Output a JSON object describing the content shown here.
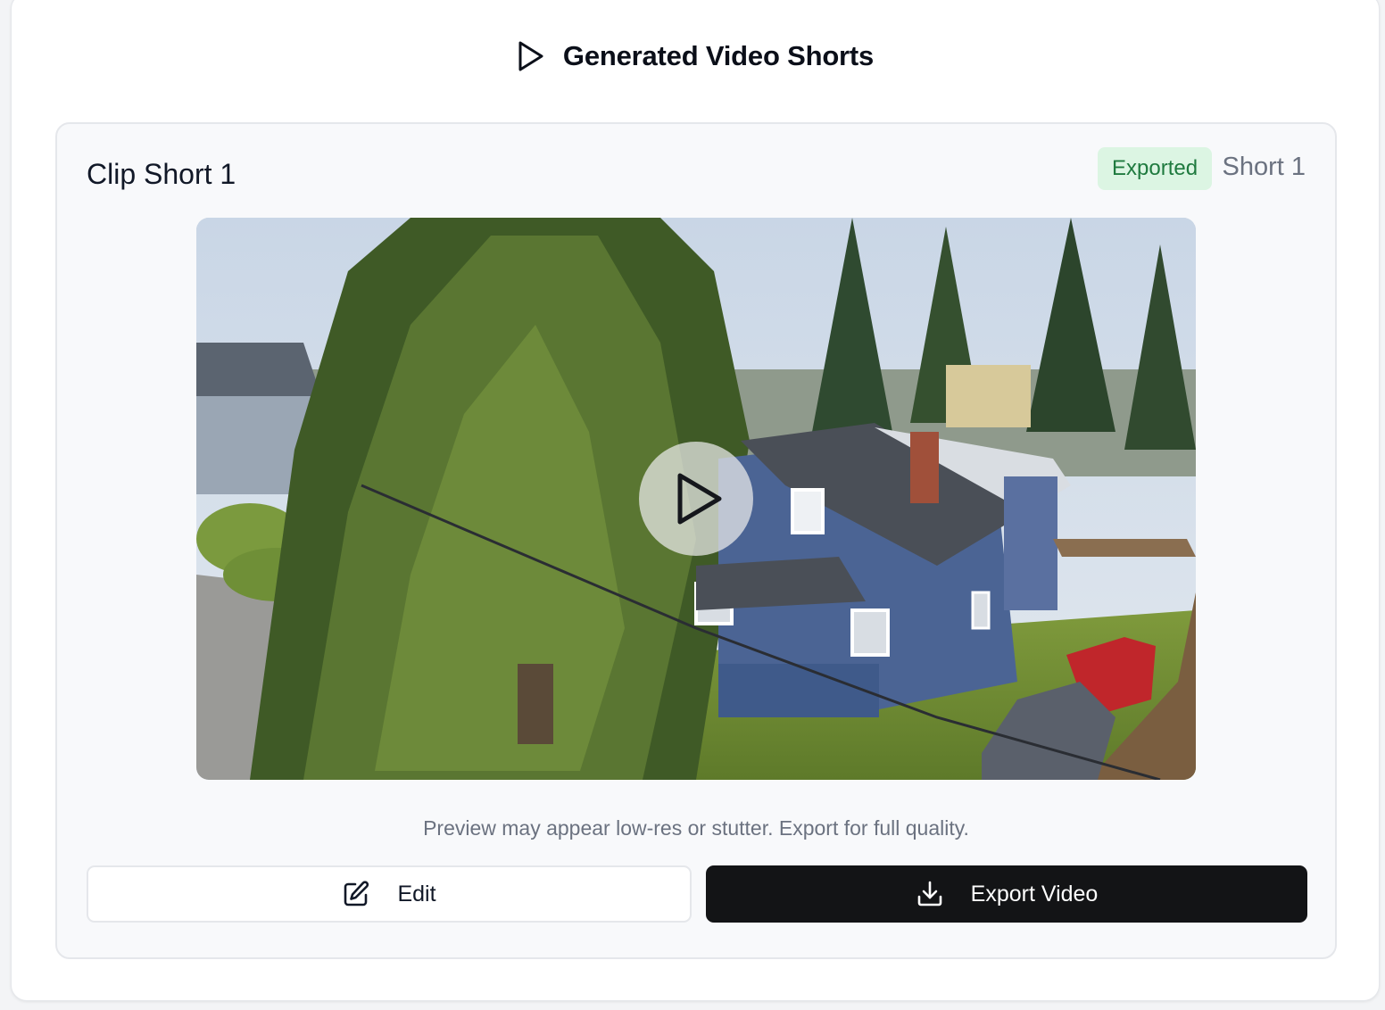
{
  "header": {
    "title": "Generated Video Shorts",
    "icon": "play-icon"
  },
  "clip": {
    "title": "Clip Short 1",
    "status_badge": "Exported",
    "short_label": "Short 1",
    "preview_note": "Preview may appear low-res or stutter. Export for full quality.",
    "video_alt": "Aerial view of a blue two-story house with a large evergreen tree and parked cars"
  },
  "actions": {
    "edit_label": "Edit",
    "edit_icon": "edit-icon",
    "export_label": "Export Video",
    "export_icon": "download-icon"
  },
  "colors": {
    "badge_bg": "#dcf5e3",
    "badge_text": "#1f7a3f",
    "export_bg": "#131416"
  }
}
